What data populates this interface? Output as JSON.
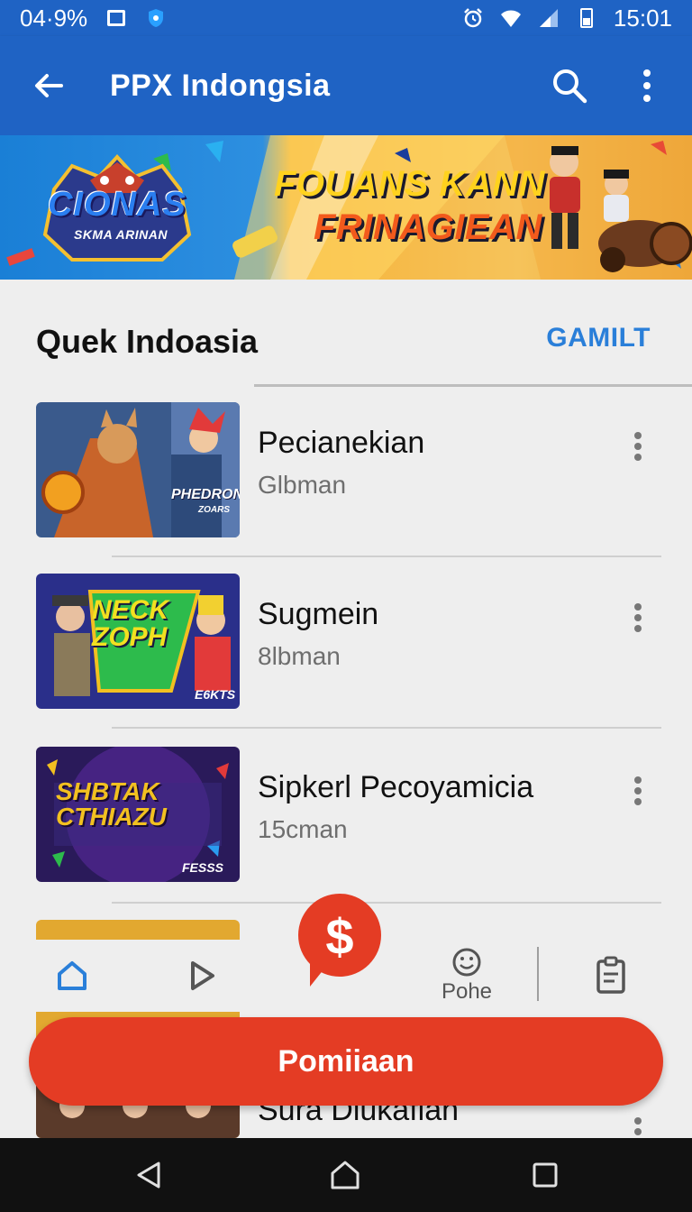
{
  "status_bar": {
    "battery_text": "04·9%",
    "time": "15:01",
    "icons": [
      "image-icon",
      "shield-icon",
      "alarm-icon",
      "wifi-icon",
      "signal-icon",
      "battery-icon"
    ]
  },
  "app_bar": {
    "title": "PPX Indongsia",
    "icons": [
      "back-arrow-icon",
      "search-icon",
      "more-vert-icon"
    ]
  },
  "banner": {
    "logo_text": "CIONAS",
    "logo_sub": "SKMA ARINAN",
    "headline_line1": "FOUANS KANN",
    "headline_line2": "FRINAGIEAN"
  },
  "section": {
    "title": "Quek Indoasia",
    "action": "GAMILT"
  },
  "games": [
    {
      "title": "Pecianekian",
      "subtitle": "Glbman",
      "thumb_label": "PHEDRON",
      "thumb_sub": "ZOARS"
    },
    {
      "title": "Sugmein",
      "subtitle": "8lbman",
      "thumb_label": "NECK ZOPH",
      "thumb_sub": "E6KTS"
    },
    {
      "title": "Sipkerl Pecoyamicia",
      "subtitle": "15cman",
      "thumb_label": "SHBTAK CTHIAZU",
      "thumb_sub": "FESSS"
    },
    {
      "title": "Sura Diukafian",
      "subtitle": ""
    }
  ],
  "bottom_nav": {
    "items": [
      {
        "icon": "home-icon",
        "label": ""
      },
      {
        "icon": "play-icon",
        "label": ""
      },
      {
        "icon": "smile-icon",
        "label": "Pohe"
      },
      {
        "icon": "clipboard-icon",
        "label": ""
      }
    ],
    "fab_symbol": "$"
  },
  "cta": {
    "label": "Pomiiaan"
  },
  "colors": {
    "primary": "#1f63c4",
    "accent": "#e43c24",
    "link": "#2a7fd9",
    "background": "#eeeeee"
  },
  "system_nav": {
    "icons": [
      "back-triangle-icon",
      "home-house-icon",
      "recents-square-icon"
    ]
  }
}
